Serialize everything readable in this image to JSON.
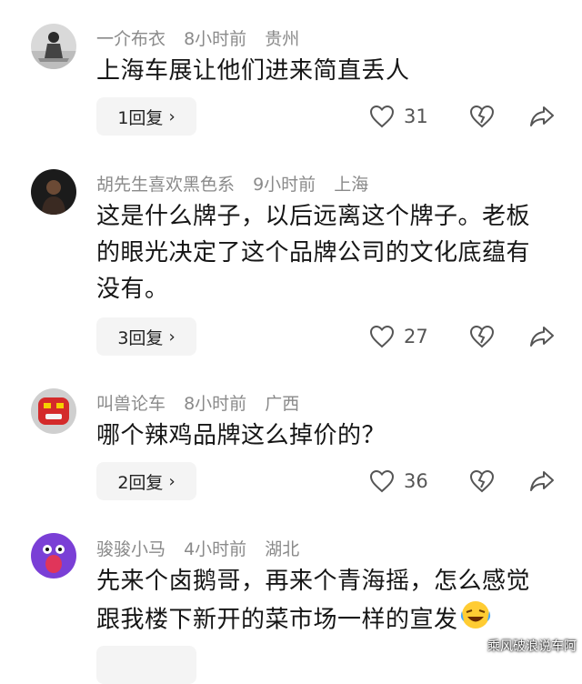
{
  "comments": [
    {
      "user": "一介布衣",
      "time": "8小时前",
      "location": "贵州",
      "text": "上海车展让他们进来简直丢人",
      "replies_label": "1回复",
      "likes": "31",
      "avatar_icon": "person-meditating-avatar"
    },
    {
      "user": "胡先生喜欢黑色系",
      "time": "9小时前",
      "location": "上海",
      "text": "这是什么牌子，以后远离这个牌子。老板的眼光决定了这个品牌公司的文化底蕴有没有。",
      "replies_label": "3回复",
      "likes": "27",
      "avatar_icon": "dark-portrait-avatar"
    },
    {
      "user": "叫兽论车",
      "time": "8小时前",
      "location": "广西",
      "text": "哪个辣鸡品牌这么掉价的？",
      "replies_label": "2回复",
      "likes": "36",
      "avatar_icon": "red-mascot-avatar"
    },
    {
      "user": "骏骏小马",
      "time": "4小时前",
      "location": "湖北",
      "text": "先来个卤鹅哥，再来个青海摇，怎么感觉跟我楼下新开的菜市场一样的宣发",
      "replies_label": "",
      "likes": "",
      "avatar_icon": "purple-screaming-avatar"
    }
  ],
  "watermark": "乘风破浪说车阿",
  "colors": {
    "meta": "#8a8a8a",
    "text": "#161616",
    "reply_bg": "#f4f4f4"
  }
}
